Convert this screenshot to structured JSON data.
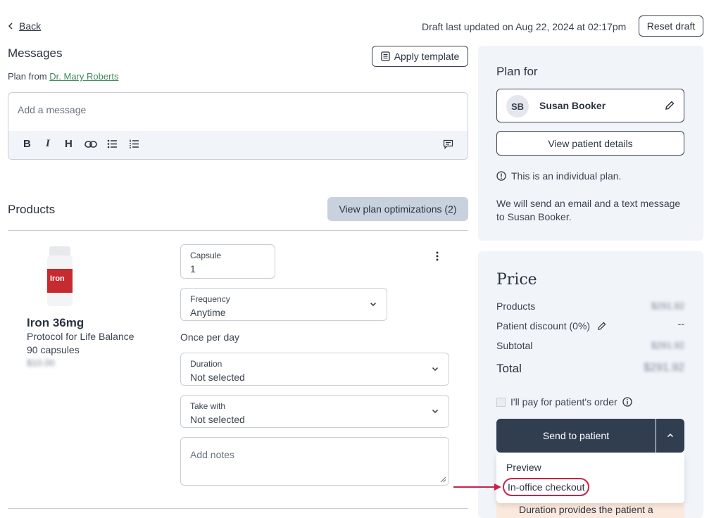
{
  "header": {
    "back_label": "Back",
    "draft_status": "Draft last updated on Aug 22, 2024 at 02:17pm",
    "reset_label": "Reset draft"
  },
  "messages": {
    "title": "Messages",
    "plan_from_prefix": "Plan from",
    "doctor": "Dr. Mary Roberts",
    "apply_template_label": "Apply template",
    "message_placeholder": "Add a message",
    "toolbar": {
      "bold": "B",
      "italic": "I",
      "heading": "H"
    }
  },
  "products": {
    "title": "Products",
    "optimizations_label": "View plan optimizations (2)",
    "item": {
      "name": "Iron 36mg",
      "brand": "Protocol for Life Balance",
      "size": "90 capsules",
      "price": "$10.00",
      "bottle_label": "Iron",
      "capsule_label": "Capsule",
      "capsule_value": "1",
      "frequency_label": "Frequency",
      "frequency_value": "Anytime",
      "frequency_hint": "Once per day",
      "duration_label": "Duration",
      "duration_value": "Not selected",
      "take_with_label": "Take with",
      "take_with_value": "Not selected",
      "notes_placeholder": "Add notes"
    }
  },
  "plan_for": {
    "title": "Plan for",
    "initials": "SB",
    "patient_name": "Susan Booker",
    "view_details_label": "View patient details",
    "individual_note": "This is an individual plan.",
    "send_note": "We will send an email and a text message to Susan Booker."
  },
  "price": {
    "title": "Price",
    "rows": [
      {
        "label": "Products",
        "value": "$291.92"
      },
      {
        "label": "Patient discount (0%)",
        "value": "--"
      },
      {
        "label": "Subtotal",
        "value": "$291.92"
      }
    ],
    "total_label": "Total",
    "total_value": "$291.92",
    "pay_label": "I'll pay for patient's order",
    "send_label": "Send to patient",
    "menu": [
      {
        "label": "Preview"
      },
      {
        "label": "In-office checkout"
      }
    ],
    "banner_text": "Duration provides the patient a"
  },
  "colors": {
    "dark_navy": "#313e50",
    "panel_bg": "#f1f4f9",
    "accent_green": "#3f8a5d",
    "highlight_red": "#c8234b",
    "optimization_btn": "#c8d1de"
  }
}
